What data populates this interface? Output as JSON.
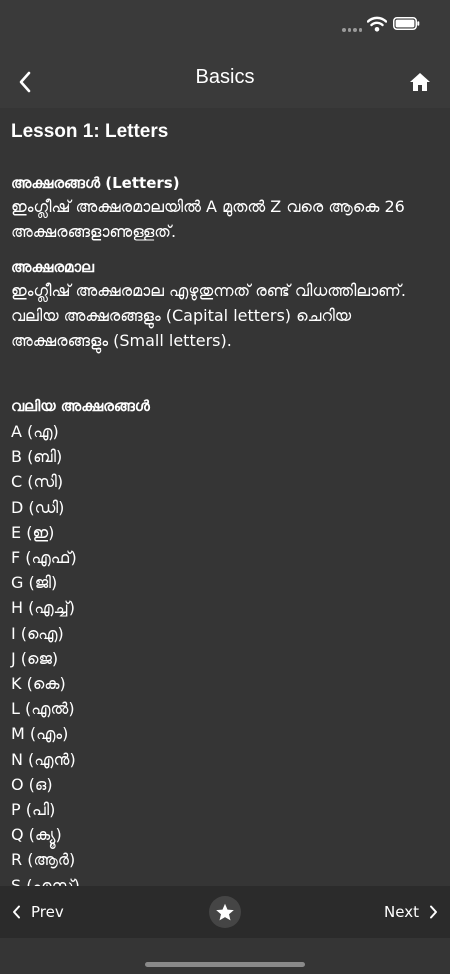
{
  "nav": {
    "title": "Basics"
  },
  "lesson": {
    "title": "Lesson 1: Letters",
    "section1": {
      "heading": "അക്ഷരങ്ങൾ (Letters)",
      "text": "ഇംഗ്ലീഷ് അക്ഷരമാലയിൽ A മുതൽ Z വരെ ആകെ 26 അക്ഷരങ്ങളാണുള്ളത്."
    },
    "section2": {
      "heading": "അക്ഷരമാല",
      "text": "ഇംഗ്ലീഷ് അക്ഷരമാല എഴുതുന്നത് രണ്ട് വിധത്തിലാണ്. വലിയ അക്ഷരങ്ങളും (Capital letters) ചെറിയ അക്ഷരങ്ങളും (Small letters)."
    },
    "section3": {
      "heading": "വലിയ അക്ഷരങ്ങൾ",
      "letters": [
        "A (എ)",
        "B (ബി)",
        "C (സി)",
        "D (ഡി)",
        "E (ഇ)",
        "F (എഫ്)",
        "G (ജി)",
        "H (എച്ച്)",
        "I (ഐ)",
        "J (ജെ)",
        "K (കെ)",
        "L (എൽ)",
        "M (എം)",
        "N (എൻ)",
        "O (ഒ)",
        "P (പി)",
        "Q (ക്യൂ)",
        "R (ആർ)",
        "S (എസ്)"
      ]
    }
  },
  "footer": {
    "prev_label": "Prev",
    "next_label": "Next"
  },
  "icons": {
    "back": "chevron-left-icon",
    "home": "home-icon",
    "star": "star-icon",
    "wifi": "wifi-icon",
    "battery": "battery-icon"
  }
}
